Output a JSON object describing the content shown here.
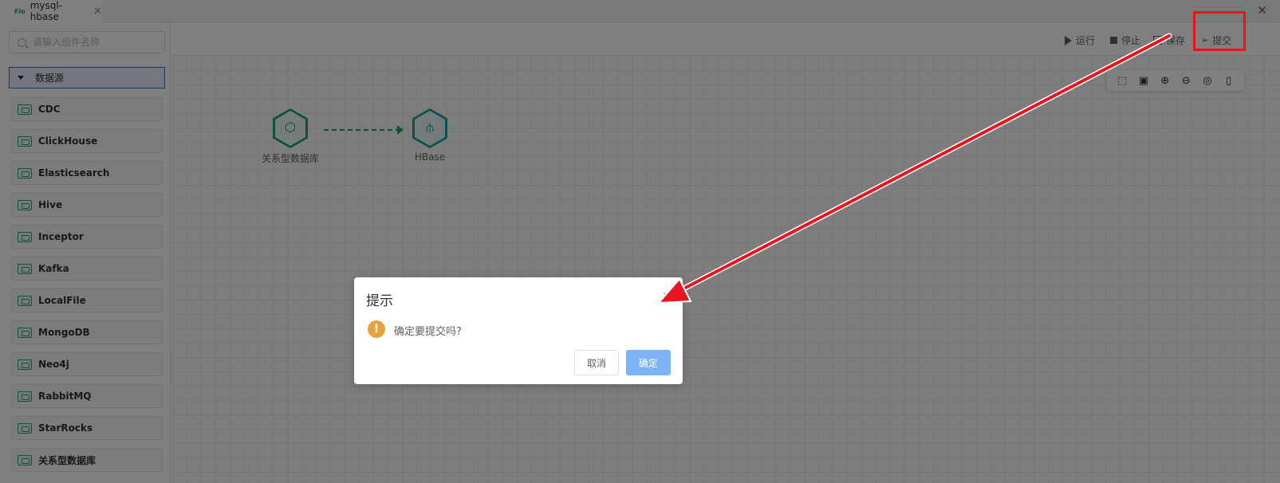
{
  "tabbar": {
    "tab_icon_text": "Flo",
    "tab_title": "mysql-hbase",
    "tab_close": "✕",
    "window_close": "✕"
  },
  "sidebar": {
    "search_placeholder": "请输入组件名称",
    "category_label": "数据源",
    "items": [
      {
        "label": "CDC"
      },
      {
        "label": "ClickHouse"
      },
      {
        "label": "Elasticsearch"
      },
      {
        "label": "Hive"
      },
      {
        "label": "Inceptor"
      },
      {
        "label": "Kafka"
      },
      {
        "label": "LocalFile"
      },
      {
        "label": "MongoDB"
      },
      {
        "label": "Neo4j"
      },
      {
        "label": "RabbitMQ"
      },
      {
        "label": "StarRocks"
      },
      {
        "label": "关系型数据库"
      }
    ]
  },
  "toolbar": {
    "run_label": "运行",
    "stop_label": "停止",
    "save_label": "保存",
    "submit_label": "提交"
  },
  "canvas": {
    "nodes": [
      {
        "label": "关系型数据库"
      },
      {
        "label": "HBase"
      }
    ]
  },
  "dialog": {
    "title": "提示",
    "message": "确定要提交吗?",
    "cancel_label": "取消",
    "ok_label": "确定",
    "warn_glyph": "!"
  },
  "colors": {
    "accent_green": "#1aa36e",
    "hbase_teal": "#1e9ea0",
    "primary_blue": "#7eb4f5",
    "annotation_red": "#e8141e",
    "warning_orange": "#e6a23c"
  }
}
